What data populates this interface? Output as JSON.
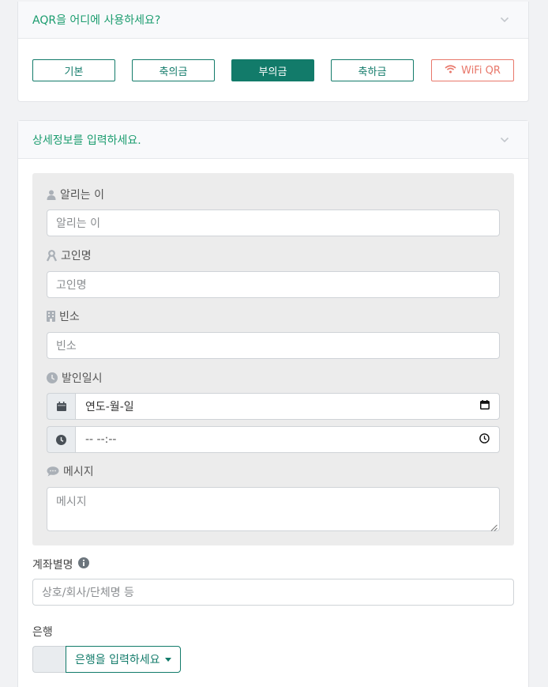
{
  "usage_section": {
    "title": "AQR을 어디에 사용하세요?",
    "types": [
      {
        "label": "기본",
        "active": false
      },
      {
        "label": "축의금",
        "active": false
      },
      {
        "label": "부의금",
        "active": true
      },
      {
        "label": "축하금",
        "active": false
      },
      {
        "label": "WiFi QR",
        "active": false,
        "icon": "wifi-icon"
      }
    ]
  },
  "details_section": {
    "title": "상세정보를 입력하세요.",
    "announcer": {
      "label": "알리는 이",
      "placeholder": "알리는 이",
      "icon": "user-icon"
    },
    "deceased": {
      "label": "고인명",
      "placeholder": "고인명",
      "icon": "ribbon-icon"
    },
    "funeral_hall": {
      "label": "빈소",
      "placeholder": "빈소",
      "icon": "building-icon"
    },
    "burial_datetime": {
      "label": "발인일시",
      "icon": "clock-icon",
      "date_value": "연도-월-일",
      "time_value": "-- --:--"
    },
    "message": {
      "label": "메시지",
      "placeholder": "메시지",
      "icon": "comment-icon"
    },
    "account_name": {
      "label": "계좌별명",
      "placeholder": "상호/회사/단체명 등",
      "icon": "info-icon"
    },
    "bank": {
      "label": "은행",
      "button_label": "은행을 입력하세요"
    }
  },
  "colors": {
    "accent": "#127b6a",
    "title_green": "#1a9c6e",
    "wifi": "#e8776a"
  }
}
